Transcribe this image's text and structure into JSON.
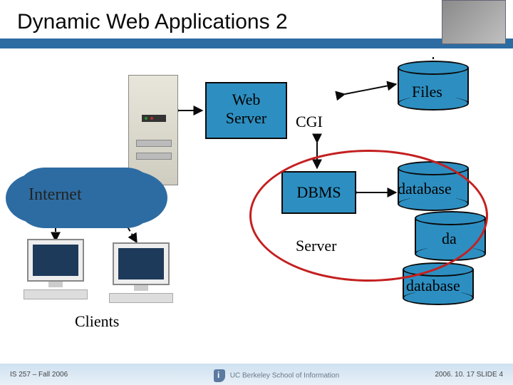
{
  "header": {
    "title": "Dynamic Web Applications 2"
  },
  "diagram": {
    "web_server": "Web\nServer",
    "cgi": "CGI",
    "internet": "Internet",
    "dbms": "DBMS",
    "server": "Server",
    "files": "Files",
    "database1": "database",
    "database2": "da",
    "database3": "database",
    "clients": "Clients"
  },
  "footer": {
    "left": "IS 257 – Fall 2006",
    "logo_text": "UC Berkeley School of Information",
    "right": "2006. 10. 17 SLIDE 4"
  }
}
